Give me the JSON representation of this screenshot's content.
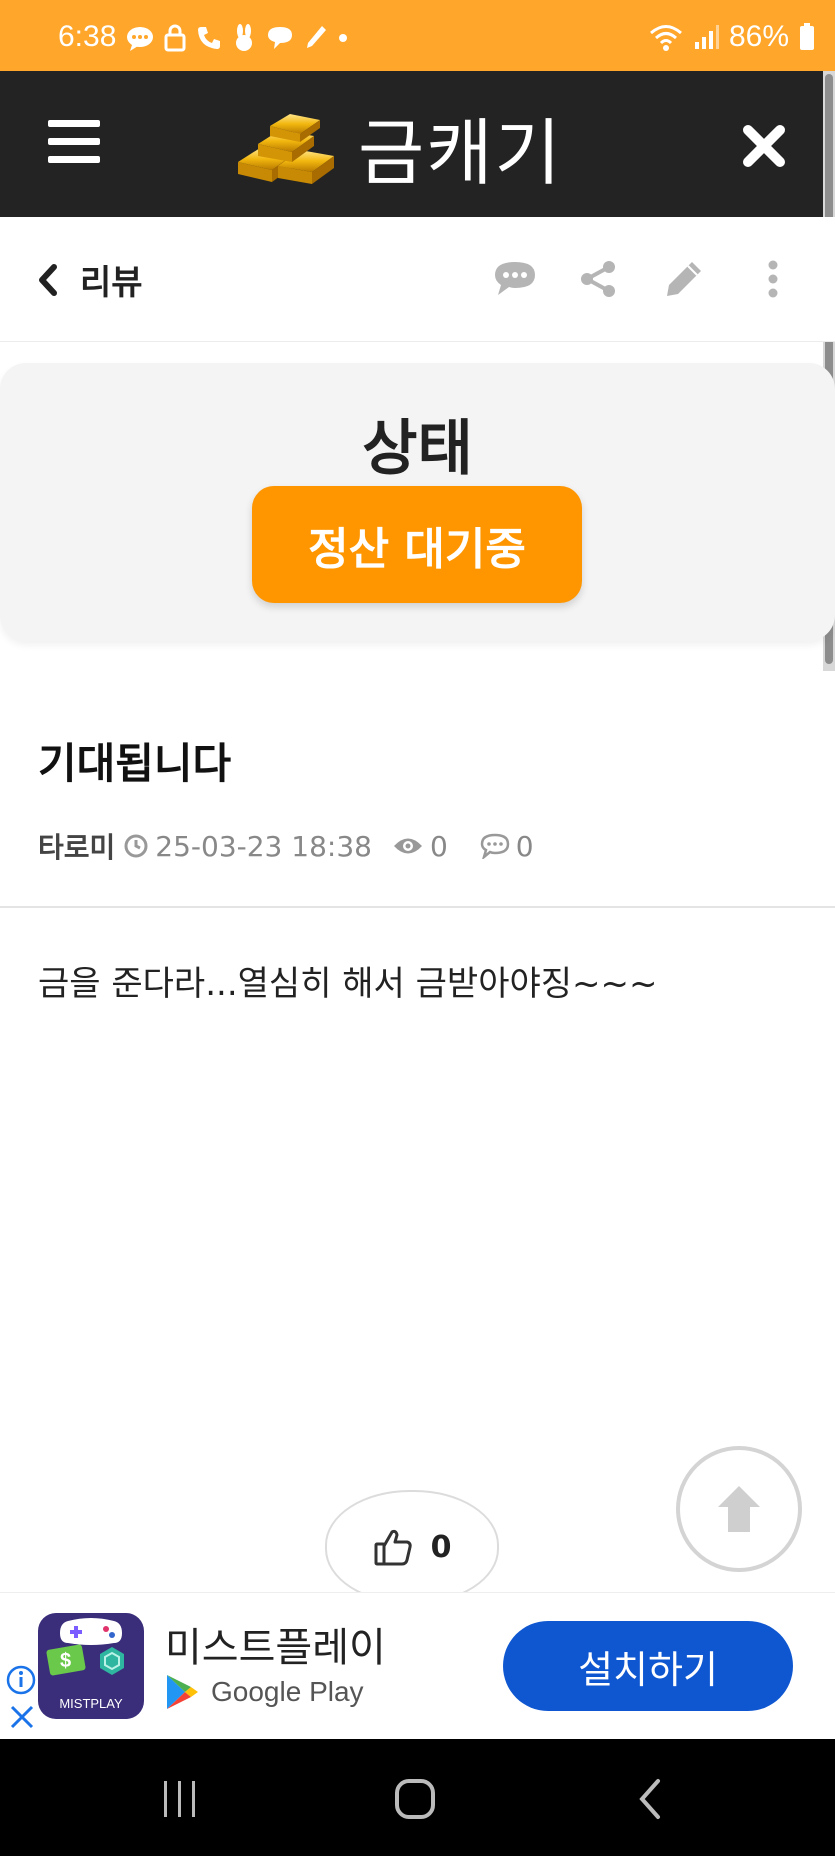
{
  "status_bar": {
    "time": "6:38",
    "battery": "86%"
  },
  "header": {
    "title": "금캐기",
    "menu_icon": "hamburger-icon",
    "close_icon": "close-icon"
  },
  "subheader": {
    "back_label": "리뷰",
    "tools": [
      "comment-icon",
      "share-icon",
      "edit-icon",
      "more-icon"
    ]
  },
  "status_card": {
    "heading": "상태",
    "badge": "정산 대기중"
  },
  "post": {
    "title": "기대됩니다",
    "author": "타로미",
    "datetime": "25-03-23 18:38",
    "views": "0",
    "comments": "0",
    "body": "금을 준다라...열심히 해서 금받아야징~~~"
  },
  "like": {
    "count": "0"
  },
  "ad": {
    "logo_text": "MISTPLAY",
    "title": "미스트플레이",
    "store": "Google Play",
    "install_label": "설치하기"
  },
  "colors": {
    "status_bar": "#ffa62b",
    "header": "#232323",
    "badge": "#ff9600",
    "install": "#0f57d1"
  }
}
